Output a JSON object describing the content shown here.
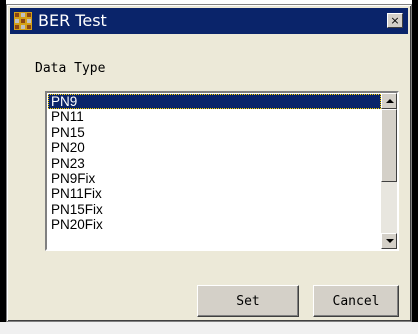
{
  "window": {
    "title": "BER Test",
    "close_label": "×"
  },
  "form": {
    "data_type_label": "Data Type"
  },
  "listbox": {
    "items": [
      "PN9",
      "PN11",
      "PN15",
      "PN20",
      "PN23",
      "PN9Fix",
      "PN11Fix",
      "PN15Fix",
      "PN20Fix"
    ],
    "selected": "PN9"
  },
  "buttons": {
    "set_label": "Set",
    "cancel_label": "Cancel"
  },
  "background": {
    "left_text": "",
    "right_text": ""
  },
  "colors": {
    "titlebar": "#0a246a",
    "dialog_face": "#ece9d8",
    "selection": "#0a246a"
  }
}
